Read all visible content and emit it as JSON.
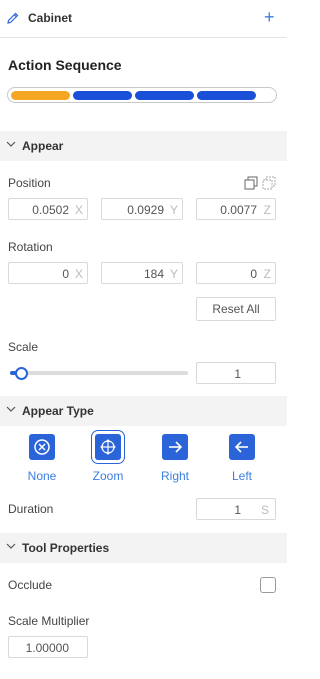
{
  "header": {
    "title": "Cabinet",
    "add_icon": "plus-icon",
    "edit_icon": "pencil-icon"
  },
  "sequence": {
    "title": "Action Sequence",
    "segments": [
      {
        "color": "#f5a623"
      },
      {
        "color": "#1a4fd8"
      },
      {
        "color": "#1a4fd8"
      },
      {
        "color": "#1a4fd8"
      }
    ]
  },
  "appear": {
    "section_label": "Appear",
    "position": {
      "label": "Position",
      "x": "0.0502",
      "y": "0.0929",
      "z": "0.0077",
      "axis_x": "X",
      "axis_y": "Y",
      "axis_z": "Z"
    },
    "rotation": {
      "label": "Rotation",
      "x": "0",
      "y": "184",
      "z": "0",
      "axis_x": "X",
      "axis_y": "Y",
      "axis_z": "Z"
    },
    "reset_label": "Reset All",
    "scale": {
      "label": "Scale",
      "value": "1",
      "slider_fraction": 0.06
    }
  },
  "appear_type": {
    "section_label": "Appear Type",
    "options": [
      {
        "label": "None",
        "icon": "circle-x-icon"
      },
      {
        "label": "Zoom",
        "icon": "move-arrows-icon",
        "selected": true
      },
      {
        "label": "Right",
        "icon": "arrow-right-icon"
      },
      {
        "label": "Left",
        "icon": "arrow-left-icon"
      }
    ],
    "duration": {
      "label": "Duration",
      "value": "1",
      "unit": "S"
    }
  },
  "tool_properties": {
    "section_label": "Tool Properties",
    "occlude_label": "Occlude",
    "occlude_checked": false,
    "scale_multiplier_label": "Scale Multiplier",
    "scale_multiplier_value": "1.00000"
  },
  "colors": {
    "accent": "#2b63d8",
    "link": "#3b7de0",
    "orange": "#f5a623"
  }
}
